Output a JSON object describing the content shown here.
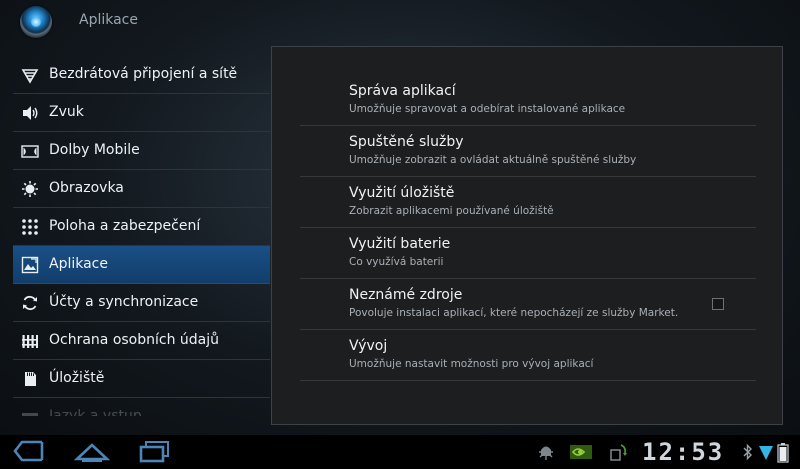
{
  "actionbar": {
    "title": "Aplikace"
  },
  "sidebar": {
    "items": [
      {
        "label": "Bezdrátová připojení a sítě",
        "icon": "wifi-icon"
      },
      {
        "label": "Zvuk",
        "icon": "speaker-icon"
      },
      {
        "label": "Dolby Mobile",
        "icon": "dolby-icon"
      },
      {
        "label": "Obrazovka",
        "icon": "brightness-icon"
      },
      {
        "label": "Poloha a zabezpečení",
        "icon": "grid-dots-icon"
      },
      {
        "label": "Aplikace",
        "icon": "apps-icon",
        "selected": true
      },
      {
        "label": "Účty a synchronizace",
        "icon": "sync-icon"
      },
      {
        "label": "Ochrana osobních údajů",
        "icon": "privacy-icon"
      },
      {
        "label": "Úložiště",
        "icon": "sdcard-icon"
      },
      {
        "label": "Jazyk a vstup",
        "icon": "keyboard-icon"
      }
    ]
  },
  "main": {
    "items": [
      {
        "title": "Správa aplikací",
        "summary": "Umožňuje spravovat a odebírat instalované aplikace"
      },
      {
        "title": "Spuštěné služby",
        "summary": "Umožňuje zobrazit a ovládat aktuálně spuštěné služby"
      },
      {
        "title": "Využití úložiště",
        "summary": "Zobrazit aplikacemi používané úložiště"
      },
      {
        "title": "Využití baterie",
        "summary": "Co využívá baterii"
      },
      {
        "title": "Neznámé zdroje",
        "summary": "Povoluje instalaci aplikací, které nepocházejí ze služby Market.",
        "checkbox": true,
        "checked": false
      },
      {
        "title": "Vývoj",
        "summary": "Umožňuje nastavit možnosti pro vývoj aplikací"
      }
    ]
  },
  "statusbar": {
    "time": "12:53"
  },
  "colors": {
    "selected": "#1a4f86",
    "panel": "#1c1e20",
    "accent": "#33b5e5"
  }
}
